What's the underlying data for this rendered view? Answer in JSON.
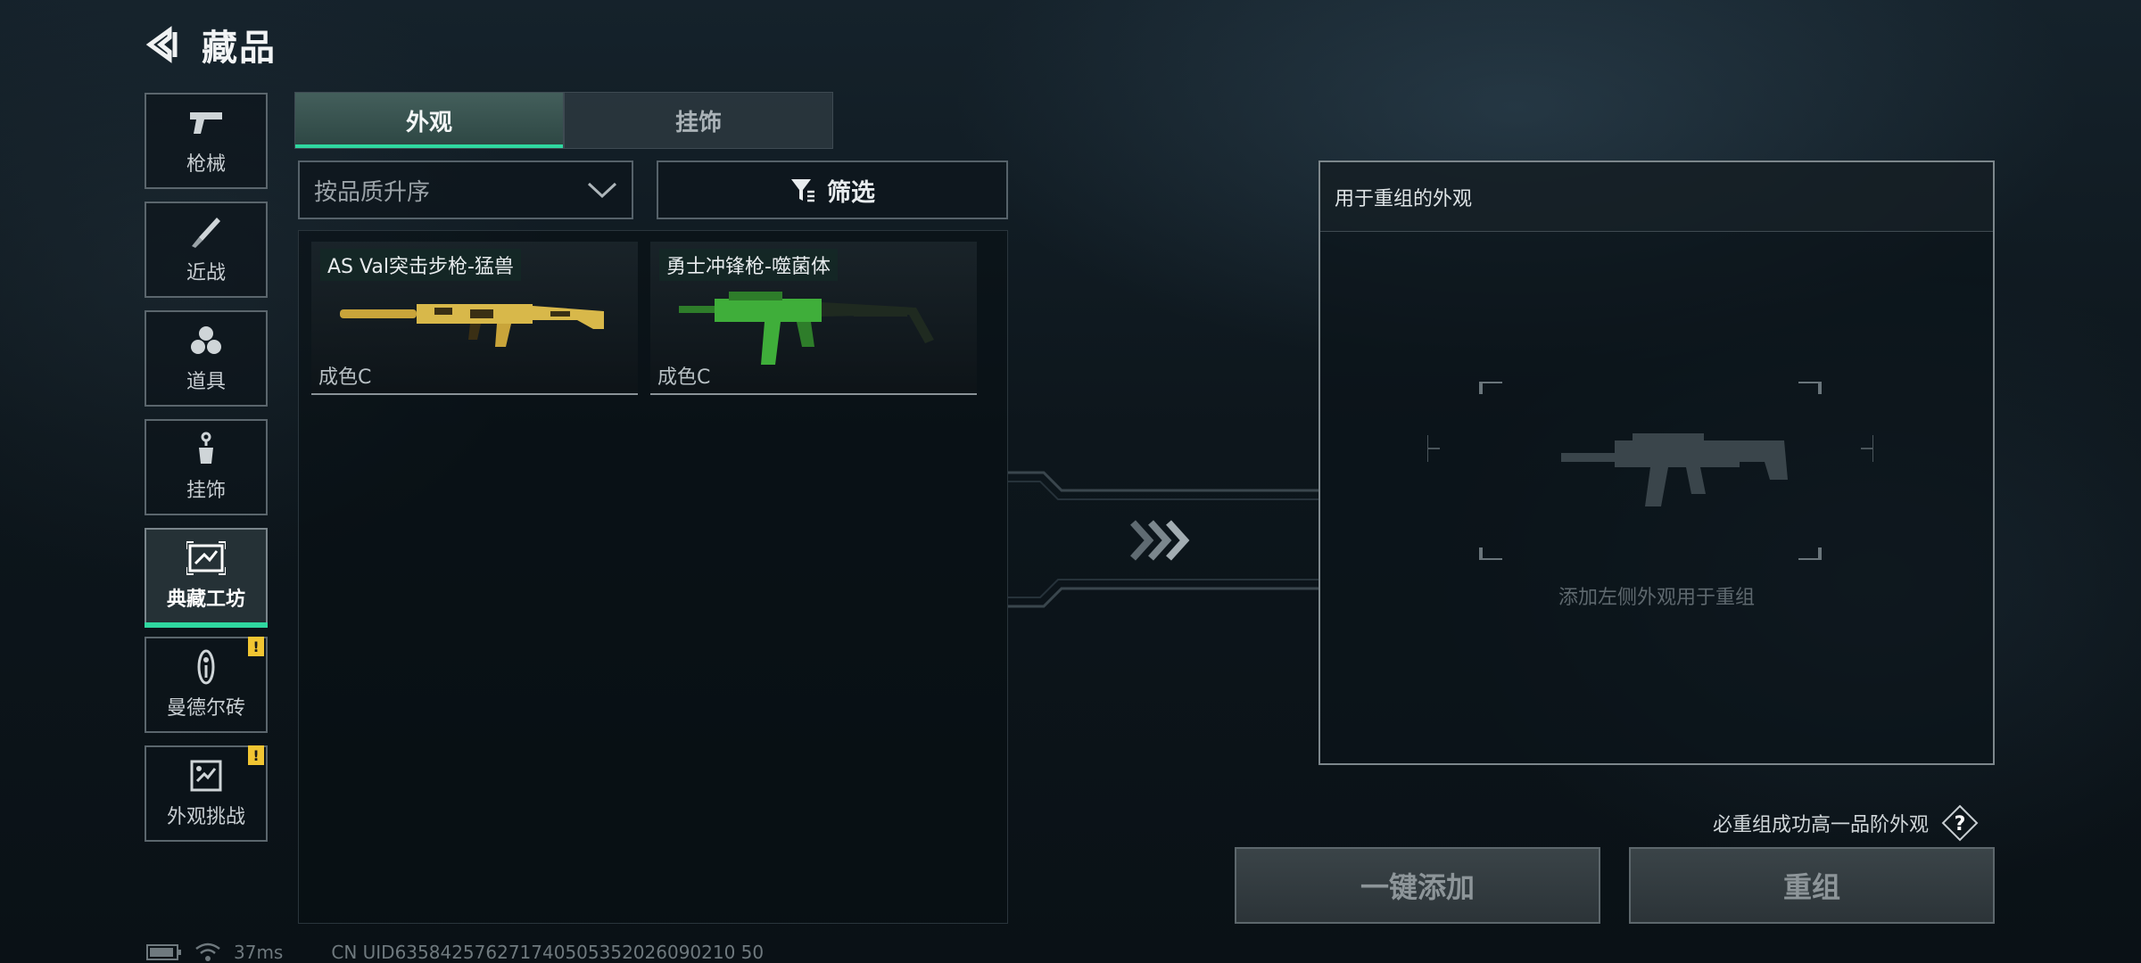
{
  "header": {
    "title": "藏品"
  },
  "sidebar": {
    "items": [
      {
        "label": "枪械",
        "icon": "pistol-icon"
      },
      {
        "label": "近战",
        "icon": "knife-icon"
      },
      {
        "label": "道具",
        "icon": "grenade-icon"
      },
      {
        "label": "挂饰",
        "icon": "charm-icon"
      },
      {
        "label": "典藏工坊",
        "icon": "workshop-icon",
        "active": true
      },
      {
        "label": "曼德尔砖",
        "icon": "mandel-brick-icon",
        "badge": "!"
      },
      {
        "label": "外观挑战",
        "icon": "challenge-icon",
        "badge": "!"
      }
    ]
  },
  "tabs": [
    {
      "label": "外观",
      "active": true
    },
    {
      "label": "挂饰",
      "active": false
    }
  ],
  "sort": {
    "label": "按品质升序"
  },
  "filter": {
    "label": "筛选"
  },
  "items": [
    {
      "name": "AS Val突击步枪-猛兽",
      "grade": "成色C",
      "color": "#d8b84a"
    },
    {
      "name": "勇士冲锋枪-噬菌体",
      "grade": "成色C",
      "color": "#3fae3a"
    }
  ],
  "recombine": {
    "title": "用于重组的外观",
    "hint": "添加左侧外观用于重组"
  },
  "guarantee": {
    "text": "必重组成功高一品阶外观",
    "help": "?"
  },
  "actions": {
    "add_all": "一键添加",
    "recombine": "重组"
  },
  "footer": {
    "ping": "37ms",
    "uid": "CN UID635842576271740505352026090210 50"
  },
  "colors": {
    "accent": "#2fd8a0",
    "badge": "#f1c532"
  }
}
